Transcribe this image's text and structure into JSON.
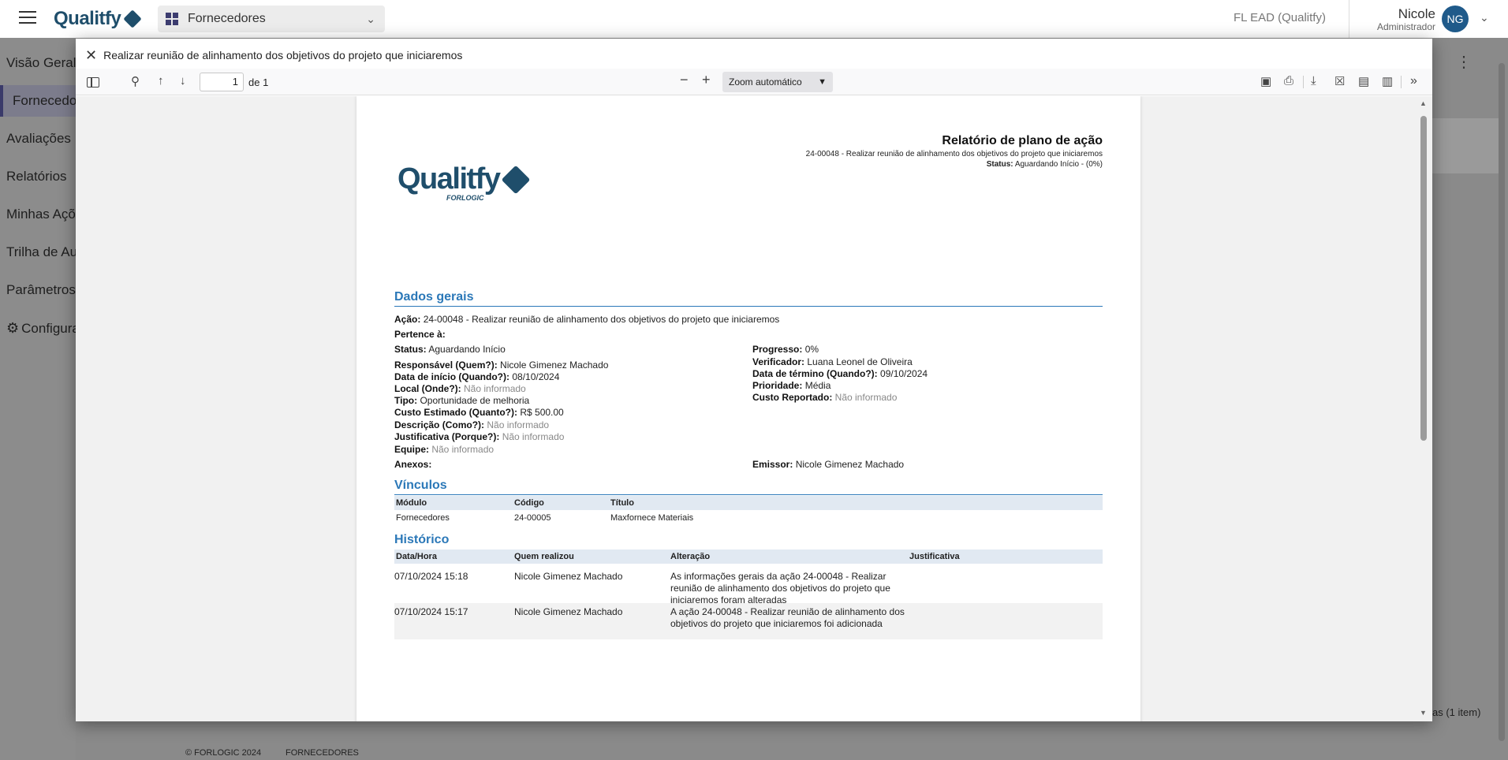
{
  "app": {
    "module": "Fornecedores",
    "company": "FL EAD (Qualitfy)",
    "user_name": "Nicole",
    "user_role": "Administrador",
    "user_initials": "NG"
  },
  "sidebar": {
    "items": [
      {
        "label": "Visão Geral"
      },
      {
        "label": "Fornecedores"
      },
      {
        "label": "Avaliações"
      },
      {
        "label": "Relatórios"
      },
      {
        "label": "Minhas Ações"
      },
      {
        "label": "Trilha de Auditoria"
      },
      {
        "label": "Parâmetros"
      },
      {
        "label": "Configurações"
      }
    ]
  },
  "background": {
    "footer_copyright": "© FORLOGIC 2024",
    "footer_module": "FORNECEDORES",
    "items_count": "as (1 item)"
  },
  "modal": {
    "title": "Realizar reunião de alinhamento dos objetivos do projeto que iniciaremos"
  },
  "toolbar": {
    "page_number": "1",
    "page_of": "de 1",
    "zoom": "Zoom automático"
  },
  "report": {
    "title": "Relatório de plano de ação",
    "subtitle": "24-00048 - Realizar reunião de alinhamento dos objetivos do projeto que iniciaremos",
    "status_label": "Status:",
    "status_value": "Aguardando Início - (0%)",
    "logo_word": "Qualitfy",
    "logo_sub": "FORLOGIC",
    "general": {
      "section_title": "Dados gerais",
      "acao_label": "Ação:",
      "acao_value": "24-00048 - Realizar reunião de alinhamento dos objetivos do projeto que iniciaremos",
      "pertence_label": "Pertence à:",
      "status_label": "Status:",
      "status_value": "Aguardando Início",
      "progresso_label": "Progresso:",
      "progresso_value": "0%",
      "responsavel_label": "Responsável (Quem?):",
      "responsavel_value": "Nicole Gimenez Machado",
      "verificador_label": "Verificador:",
      "verificador_value": "Luana Leonel de Oliveira",
      "inicio_label": "Data de início (Quando?):",
      "inicio_value": "08/10/2024",
      "termino_label": "Data de término (Quando?):",
      "termino_value": "09/10/2024",
      "local_label": "Local (Onde?):",
      "local_value": "Não informado",
      "prioridade_label": "Prioridade:",
      "prioridade_value": "Média",
      "tipo_label": "Tipo:",
      "tipo_value": "Oportunidade de melhoria",
      "custo_rep_label": "Custo Reportado:",
      "custo_rep_value": "Não informado",
      "custo_est_label": "Custo Estimado (Quanto?):",
      "custo_est_value": "R$ 500.00",
      "descricao_label": "Descrição (Como?):",
      "descricao_value": "Não informado",
      "justificativa_label": "Justificativa (Porque?):",
      "justificativa_value": "Não informado",
      "equipe_label": "Equipe:",
      "equipe_value": "Não informado",
      "anexos_label": "Anexos:",
      "emissor_label": "Emissor:",
      "emissor_value": "Nicole Gimenez Machado"
    },
    "links": {
      "section_title": "Vínculos",
      "columns": [
        "Módulo",
        "Código",
        "Título"
      ],
      "rows": [
        [
          "Fornecedores",
          "24-00005",
          "Maxfornece Materiais"
        ]
      ]
    },
    "history": {
      "section_title": "Histórico",
      "columns": [
        "Data/Hora",
        "Quem realizou",
        "Alteração",
        "Justificativa"
      ],
      "rows": [
        [
          "07/10/2024 15:18",
          "Nicole Gimenez Machado",
          "As informações gerais da ação 24-00048 - Realizar reunião de alinhamento dos objetivos do projeto que iniciaremos foram alteradas",
          ""
        ],
        [
          "07/10/2024 15:17",
          "Nicole Gimenez Machado",
          "A ação 24-00048 - Realizar reunião de alinhamento dos objetivos do projeto que iniciaremos foi adicionada",
          ""
        ]
      ]
    }
  }
}
